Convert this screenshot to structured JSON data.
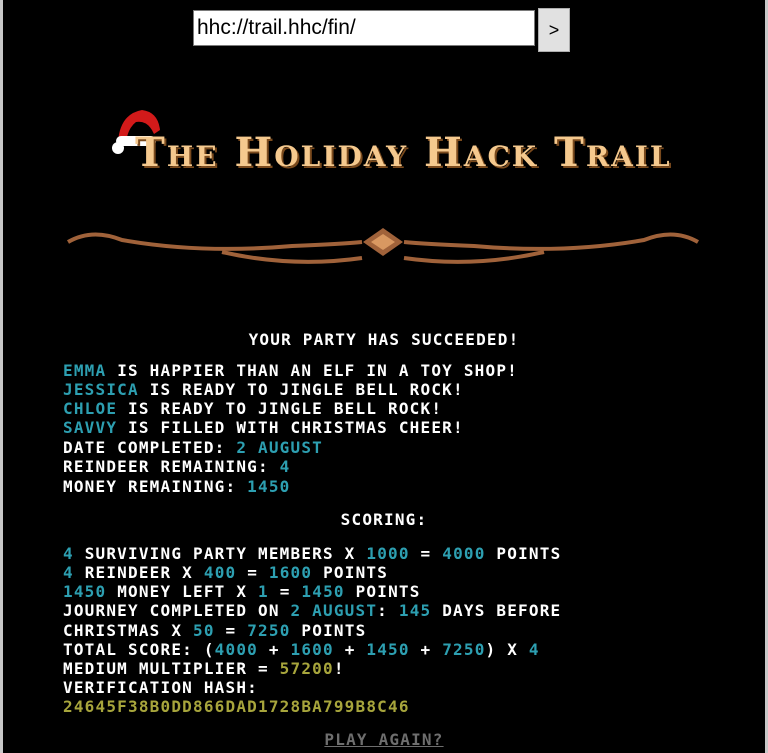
{
  "browser": {
    "url": "hhc://trail.hhc/fin/",
    "go_label": ">"
  },
  "game": {
    "title": "The Holiday Hack Trail",
    "result": "Your party has succeeded!",
    "party": [
      {
        "name": "Emma",
        "status": "is happier than an elf in a toy shop!"
      },
      {
        "name": "Jessica",
        "status": "is ready to jingle bell rock!"
      },
      {
        "name": "Chloe",
        "status": "is ready to jingle bell rock!"
      },
      {
        "name": "Savvy",
        "status": "is filled with Christmas cheer!"
      }
    ],
    "stats": {
      "date_label": "Date completed:",
      "date_value": "2 August",
      "reindeer_label": "Reindeer remaining:",
      "reindeer_value": "4",
      "money_label": "Money remaining:",
      "money_value": "1450"
    },
    "scoring_header": "Scoring:",
    "scoring": {
      "members_count": "4",
      "members_text": "surviving party members x",
      "members_mult": "1000",
      "eq": "=",
      "members_points": "4000",
      "points_word": "points",
      "reindeer_count": "4",
      "reindeer_text": "reindeer x",
      "reindeer_mult": "400",
      "reindeer_points": "1600",
      "money_amount": "1450",
      "money_text": "money left x",
      "money_mult": "1",
      "money_points": "1450",
      "journey_text": "journey completed on",
      "journey_date": "2 August",
      "journey_colon": ":",
      "days": "145",
      "days_text": "days before",
      "christmas_text": "Christmas x",
      "christmas_mult": "50",
      "christmas_points": "7250",
      "total_label": "Total score:",
      "total_a": "4000",
      "total_b": "1600",
      "total_c": "1450",
      "total_d": "7250",
      "total_mult": "4",
      "multiplier_label": "Medium multiplier =",
      "final_score": "57200",
      "hash_label": "Verification hash:",
      "hash": "24645F38B0DD866DAD1728BA799B8C46"
    },
    "play_again": "Play again?"
  }
}
